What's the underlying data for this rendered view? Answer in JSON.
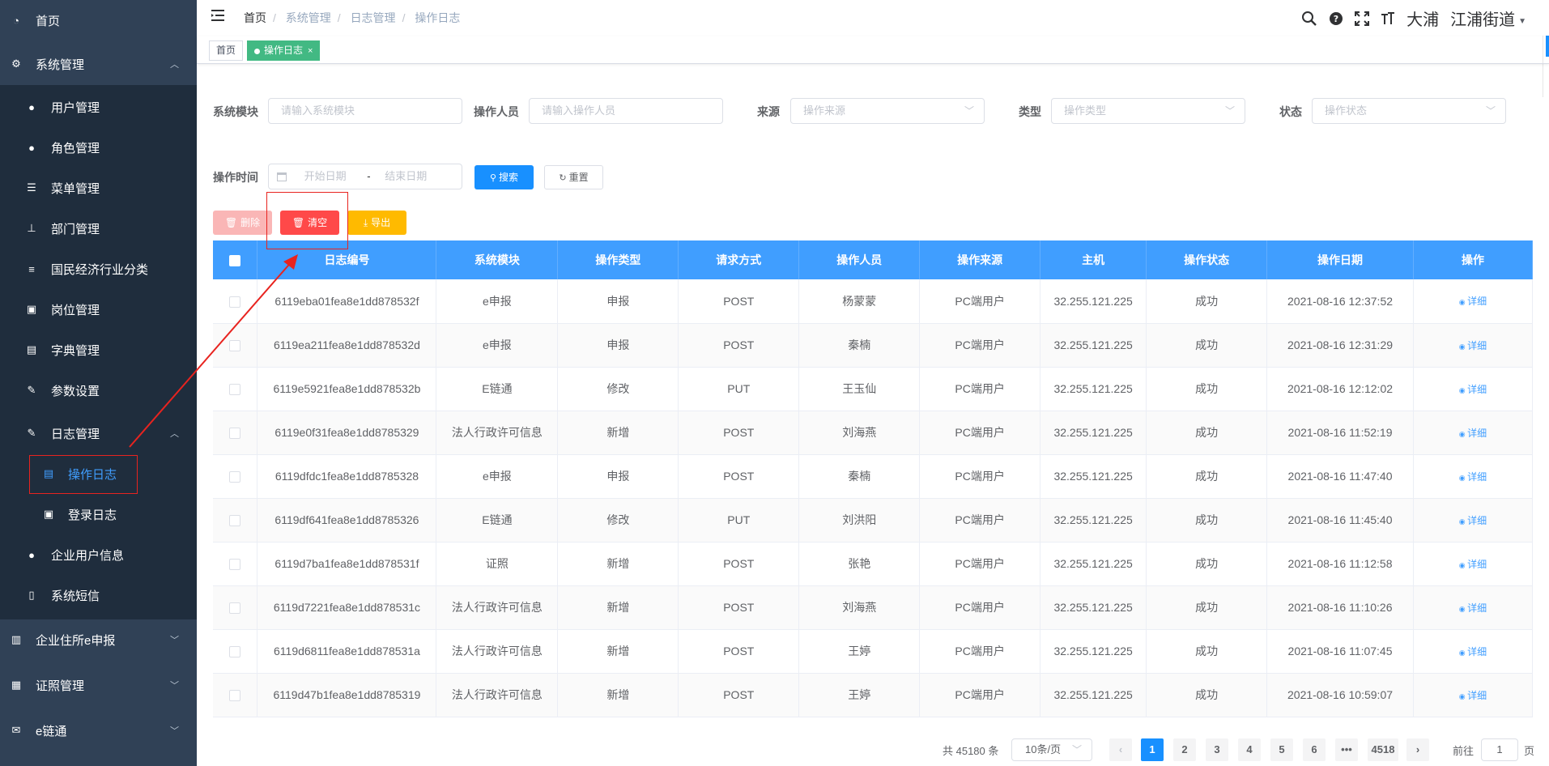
{
  "sidebar": {
    "items": [
      {
        "label": "首页",
        "icon": "dashboard-icon"
      },
      {
        "label": "系统管理",
        "icon": "gear-icon"
      },
      {
        "label": "用户管理",
        "icon": "user-icon"
      },
      {
        "label": "角色管理",
        "icon": "users-icon"
      },
      {
        "label": "菜单管理",
        "icon": "menu-tree-icon"
      },
      {
        "label": "部门管理",
        "icon": "org-tree-icon"
      },
      {
        "label": "国民经济行业分类",
        "icon": "sliders-icon"
      },
      {
        "label": "岗位管理",
        "icon": "post-icon"
      },
      {
        "label": "字典管理",
        "icon": "book-icon"
      },
      {
        "label": "参数设置",
        "icon": "edit-icon"
      },
      {
        "label": "日志管理",
        "icon": "log-icon"
      },
      {
        "label": "操作日志",
        "icon": "form-icon"
      },
      {
        "label": "登录日志",
        "icon": "login-log-icon"
      },
      {
        "label": "企业用户信息",
        "icon": "peoples-icon"
      },
      {
        "label": "系统短信",
        "icon": "phone-icon"
      },
      {
        "label": "企业住所e申报",
        "icon": "notebook-icon"
      },
      {
        "label": "证照管理",
        "icon": "grid-icon"
      },
      {
        "label": "e链通",
        "icon": "mail-icon"
      }
    ]
  },
  "breadcrumb": [
    "首页",
    "系统管理",
    "日志管理",
    "操作日志"
  ],
  "navbar": {
    "username": "大浦",
    "street": "江浦街道"
  },
  "tags": [
    {
      "label": "首页"
    },
    {
      "label": "操作日志",
      "close": "×"
    }
  ],
  "search": {
    "module_label": "系统模块",
    "module_placeholder": "请输入系统模块",
    "operator_label": "操作人员",
    "operator_placeholder": "请输入操作人员",
    "source_label": "来源",
    "source_placeholder": "操作来源",
    "type_label": "类型",
    "type_placeholder": "操作类型",
    "status_label": "状态",
    "status_placeholder": "操作状态",
    "time_label": "操作时间",
    "start_placeholder": "开始日期",
    "range_sep": "-",
    "end_placeholder": "结束日期",
    "search_btn": "搜索",
    "reset_btn": "重置"
  },
  "toolbar": {
    "delete_btn": "删除",
    "clear_btn": "清空",
    "export_btn": "导出"
  },
  "table": {
    "headers": [
      "日志编号",
      "系统模块",
      "操作类型",
      "请求方式",
      "操作人员",
      "操作来源",
      "主机",
      "操作状态",
      "操作日期",
      "操作"
    ],
    "detail_label": "详细",
    "rows": [
      [
        "6119eba01fea8e1dd878532f",
        "e申报",
        "申报",
        "POST",
        "杨蒙蒙",
        "PC端用户",
        "32.255.121.225",
        "成功",
        "2021-08-16 12:37:52"
      ],
      [
        "6119ea211fea8e1dd878532d",
        "e申报",
        "申报",
        "POST",
        "秦楠",
        "PC端用户",
        "32.255.121.225",
        "成功",
        "2021-08-16 12:31:29"
      ],
      [
        "6119e5921fea8e1dd878532b",
        "E链通",
        "修改",
        "PUT",
        "王玉仙",
        "PC端用户",
        "32.255.121.225",
        "成功",
        "2021-08-16 12:12:02"
      ],
      [
        "6119e0f31fea8e1dd8785329",
        "法人行政许可信息",
        "新增",
        "POST",
        "刘海燕",
        "PC端用户",
        "32.255.121.225",
        "成功",
        "2021-08-16 11:52:19"
      ],
      [
        "6119dfdc1fea8e1dd8785328",
        "e申报",
        "申报",
        "POST",
        "秦楠",
        "PC端用户",
        "32.255.121.225",
        "成功",
        "2021-08-16 11:47:40"
      ],
      [
        "6119df641fea8e1dd8785326",
        "E链通",
        "修改",
        "PUT",
        "刘洪阳",
        "PC端用户",
        "32.255.121.225",
        "成功",
        "2021-08-16 11:45:40"
      ],
      [
        "6119d7ba1fea8e1dd878531f",
        "证照",
        "新增",
        "POST",
        "张艳",
        "PC端用户",
        "32.255.121.225",
        "成功",
        "2021-08-16 11:12:58"
      ],
      [
        "6119d7221fea8e1dd878531c",
        "法人行政许可信息",
        "新增",
        "POST",
        "刘海燕",
        "PC端用户",
        "32.255.121.225",
        "成功",
        "2021-08-16 11:10:26"
      ],
      [
        "6119d6811fea8e1dd878531a",
        "法人行政许可信息",
        "新增",
        "POST",
        "王婷",
        "PC端用户",
        "32.255.121.225",
        "成功",
        "2021-08-16 11:07:45"
      ],
      [
        "6119d47b1fea8e1dd8785319",
        "法人行政许可信息",
        "新增",
        "POST",
        "王婷",
        "PC端用户",
        "32.255.121.225",
        "成功",
        "2021-08-16 10:59:07"
      ]
    ]
  },
  "pagination": {
    "total": "共 45180 条",
    "page_size": "10条/页",
    "pages": [
      "1",
      "2",
      "3",
      "4",
      "5",
      "6",
      "•••",
      "4518"
    ],
    "goto_label": "前往",
    "goto_value": "1",
    "goto_suffix": "页"
  },
  "colors": {
    "sidebar_bg": "#304156",
    "primary": "#409eff",
    "danger": "#ff4949",
    "warning": "#ffba00",
    "tag_active": "#42b983",
    "annotation": "#e8231f"
  }
}
